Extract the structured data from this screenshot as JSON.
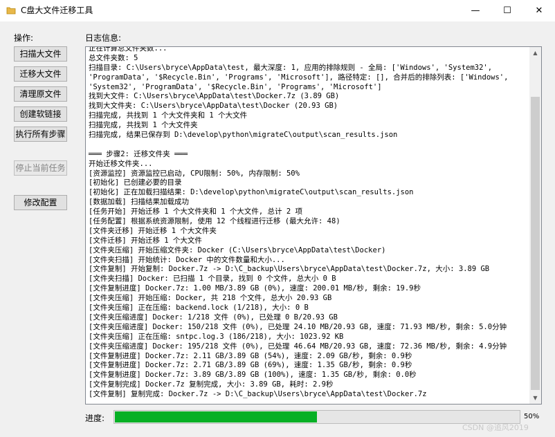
{
  "window": {
    "title": "C盘大文件迁移工具",
    "min_glyph": "—",
    "max_glyph": "☐",
    "close_glyph": "✕"
  },
  "operations": {
    "label": "操作:",
    "buttons": [
      {
        "label": "扫描大文件",
        "enabled": true
      },
      {
        "label": "迁移大文件",
        "enabled": true
      },
      {
        "label": "清理原文件",
        "enabled": true
      },
      {
        "label": "创建软链接",
        "enabled": true
      },
      {
        "label": "执行所有步骤",
        "enabled": true
      },
      {
        "label": "停止当前任务",
        "enabled": false
      },
      {
        "label": "修改配置",
        "enabled": true
      }
    ]
  },
  "log": {
    "label": "日志信息:",
    "lines": [
      "正在计算总文件夹数...",
      "总文件夹数: 5",
      "扫描目录: C:\\Users\\bryce\\AppData\\test, 最大深度: 1, 应用的排除规则 - 全局: ['Windows', 'System32',",
      "'ProgramData', '$Recycle.Bin', 'Programs', 'Microsoft'], 路径特定: [], 合并后的排除列表: ['Windows',",
      "'System32', 'ProgramData', '$Recycle.Bin', 'Programs', 'Microsoft']",
      "找到大文件: C:\\Users\\bryce\\AppData\\test\\Docker.7z (3.89 GB)",
      "找到大文件夹: C:\\Users\\bryce\\AppData\\test\\Docker (20.93 GB)",
      "扫描完成, 共找到 1 个大文件夹和 1 个大文件",
      "扫描完成, 共找到 1 个大文件夹",
      "扫描完成, 结果已保存到 D:\\develop\\python\\migrateC\\output\\scan_results.json",
      "",
      "═══ 步骤2: 迁移文件夹 ═══",
      "开始迁移文件夹...",
      "[资源监控] 资源监控已启动, CPU限制: 50%, 内存限制: 50%",
      "[初始化] 已创建必要的目录",
      "[初始化] 正在加载扫描结果: D:\\develop\\python\\migrateC\\output\\scan_results.json",
      "[数据加载] 扫描结果加载成功",
      "[任务开始] 开始迁移 1 个大文件夹和 1 个大文件, 总计 2 项",
      "[任务配置] 根据系统资源限制, 使用 12 个线程进行迁移 (最大允许: 48)",
      "[文件夹迁移] 开始迁移 1 个大文件夹",
      "[文件迁移] 开始迁移 1 个大文件",
      "[文件夹压缩] 开始压缩文件夹: Docker (C:\\Users\\bryce\\AppData\\test\\Docker)",
      "[文件夹扫描] 开始统计: Docker 中的文件数量和大小...",
      "[文件复制] 开始复制: Docker.7z -> D:\\C_backup\\Users\\bryce\\AppData\\test\\Docker.7z, 大小: 3.89 GB",
      "[文件夹扫描] Docker: 已扫描 1 个目录, 找到 0 个文件, 总大小 0 B",
      "[文件复制进度] Docker.7z: 1.00 MB/3.89 GB (0%), 速度: 200.01 MB/秒, 剩余: 19.9秒",
      "[文件夹压缩] 开始压缩: Docker, 共 218 个文件, 总大小 20.93 GB",
      "[文件夹压缩] 正在压缩: backend.lock (1/218), 大小: 0 B",
      "[文件夹压缩进度] Docker: 1/218 文件 (0%), 已处理 0 B/20.93 GB",
      "[文件夹压缩进度] Docker: 150/218 文件 (0%), 已处理 24.10 MB/20.93 GB, 速度: 71.93 MB/秒, 剩余: 5.0分钟",
      "[文件夹压缩] 正在压缩: sntpc.log.3 (186/218), 大小: 1023.92 KB",
      "[文件夹压缩进度] Docker: 195/218 文件 (0%), 已处理 46.64 MB/20.93 GB, 速度: 72.36 MB/秒, 剩余: 4.9分钟",
      "[文件复制进度] Docker.7z: 2.11 GB/3.89 GB (54%), 速度: 2.09 GB/秒, 剩余: 0.9秒",
      "[文件复制进度] Docker.7z: 2.71 GB/3.89 GB (69%), 速度: 1.35 GB/秒, 剩余: 0.9秒",
      "[文件复制进度] Docker.7z: 3.89 GB/3.89 GB (100%), 速度: 1.35 GB/秒, 剩余: 0.0秒",
      "[文件复制完成] Docker.7z 复制完成, 大小: 3.89 GB, 耗时: 2.9秒",
      "[文件复制] 复制完成: Docker.7z -> D:\\C_backup\\Users\\bryce\\AppData\\test\\Docker.7z"
    ]
  },
  "progress": {
    "label": "进度:",
    "value": 0.5,
    "percent_text": "50%",
    "color": "#06b025"
  },
  "watermark": "CSDN @追风2019"
}
